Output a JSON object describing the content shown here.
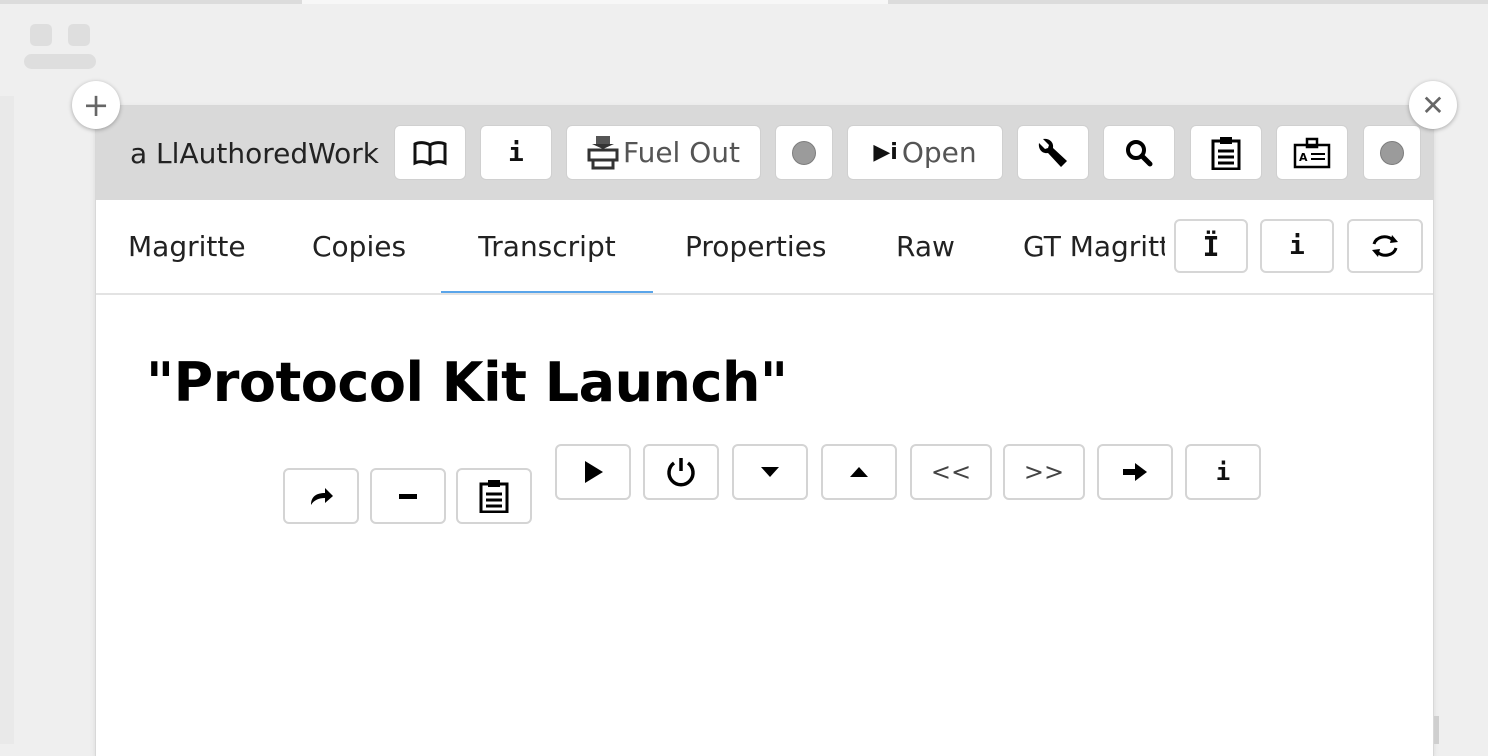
{
  "window": {
    "title": "a LlAuthoredWork",
    "header_buttons": [
      {
        "icon": "book-icon",
        "glyph": "📖"
      },
      {
        "icon": "info-icon",
        "glyph": "i"
      },
      {
        "icon": "printer-icon",
        "glyph": "🖶",
        "label": "Fuel Out"
      },
      {
        "icon": "gray-dot-icon"
      },
      {
        "icon": "play-info-icon",
        "glyph": "▶i",
        "label": "Open"
      },
      {
        "icon": "wrench-icon",
        "glyph": "🔧"
      },
      {
        "icon": "search-icon",
        "glyph": "🔍"
      },
      {
        "icon": "clipboard-icon",
        "glyph": "📋"
      },
      {
        "icon": "id-card-icon",
        "glyph": "🪪"
      },
      {
        "icon": "gray-dot-icon"
      }
    ]
  },
  "tabs": {
    "items": [
      "Magritte",
      "Copies",
      "Transcript",
      "Properties",
      "Raw",
      "GT Magritte"
    ],
    "active": "Transcript",
    "buttons": [
      {
        "icon": "i-beam-icon",
        "glyph": "Ï"
      },
      {
        "icon": "info-icon",
        "glyph": "i"
      },
      {
        "icon": "refresh-icon",
        "glyph": "⟳"
      }
    ]
  },
  "content": {
    "title": "\"Protocol Kit Launch\"",
    "toolbar_left": [
      {
        "icon": "share-icon",
        "glyph": "↪"
      },
      {
        "icon": "minus-icon",
        "glyph": "−"
      },
      {
        "icon": "clipboard-icon",
        "glyph": "📋"
      }
    ],
    "toolbar_right": [
      {
        "icon": "play-icon",
        "glyph": "▶"
      },
      {
        "icon": "power-icon",
        "glyph": "⏻"
      },
      {
        "icon": "caret-down-icon",
        "glyph": "▼"
      },
      {
        "icon": "caret-up-icon",
        "glyph": "▲"
      },
      {
        "icon": "rewind-label",
        "text": "<<"
      },
      {
        "icon": "forward-label",
        "text": ">>"
      },
      {
        "icon": "arrow-right-icon",
        "glyph": "➜"
      },
      {
        "icon": "info-icon",
        "glyph": "i"
      }
    ]
  },
  "corner_buttons": {
    "add": "+",
    "close": "✕"
  },
  "colors": {
    "active_tab_underline": "#5aa5ea",
    "header_bg": "#d9d9d9",
    "page_bg": "#efefef"
  }
}
